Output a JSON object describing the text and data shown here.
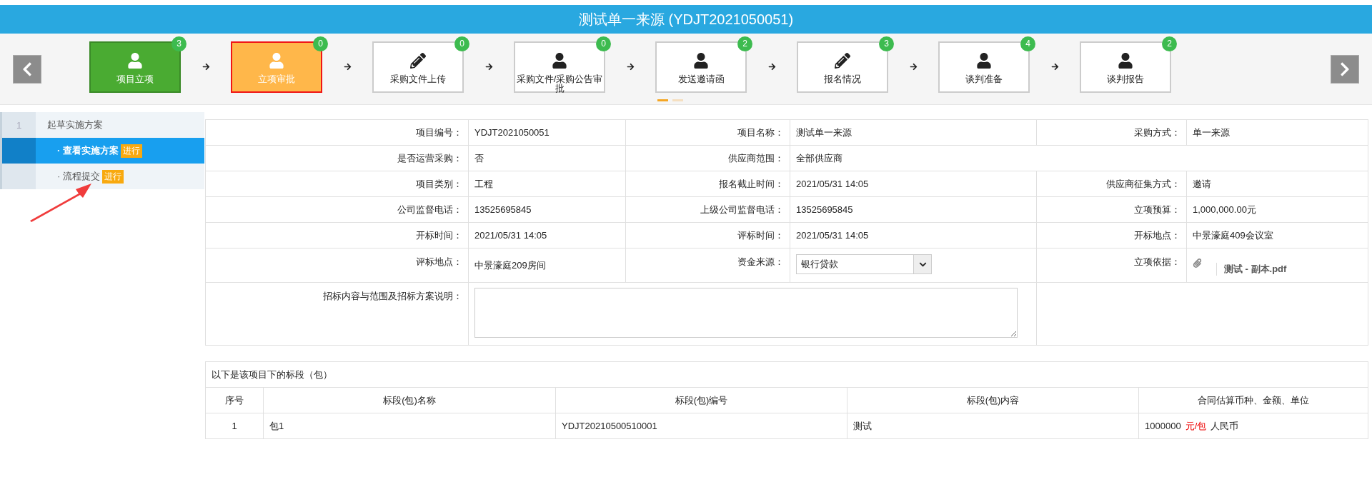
{
  "title": "测试单一来源 (YDJT2021050051)",
  "steps": [
    {
      "label": "项目立项",
      "badge": "3",
      "kind": "user",
      "done": true,
      "selected": false
    },
    {
      "label": "立项审批",
      "badge": "0",
      "kind": "user",
      "done": false,
      "selected": true
    },
    {
      "label": "采购文件上传",
      "badge": "0",
      "kind": "pencil",
      "done": false,
      "selected": false
    },
    {
      "label": "采购文件/采购公告审批",
      "badge": "0",
      "kind": "user",
      "done": false,
      "selected": false
    },
    {
      "label": "发送邀请函",
      "badge": "2",
      "kind": "user",
      "done": false,
      "selected": false
    },
    {
      "label": "报名情况",
      "badge": "3",
      "kind": "pencil",
      "done": false,
      "selected": false
    },
    {
      "label": "谈判准备",
      "badge": "4",
      "kind": "user",
      "done": false,
      "selected": false
    },
    {
      "label": "谈判报告",
      "badge": "2",
      "kind": "user",
      "done": false,
      "selected": false
    }
  ],
  "pager": [
    {
      "selected": true
    },
    {
      "selected": false
    }
  ],
  "sidebar": {
    "number": "1",
    "label": "起草实施方案",
    "items": [
      {
        "label": "· 查看实施方案",
        "badge": "进行",
        "selected": true
      },
      {
        "label": "· 流程提交",
        "badge": "进行",
        "selected": false
      }
    ]
  },
  "form": [
    [
      {
        "label": "项目编号：",
        "value": "YDJT2021050051",
        "kind": "text"
      },
      {
        "label": "项目名称：",
        "value": "测试单一来源",
        "kind": "text"
      },
      {
        "label": "采购方式：",
        "value": "单一来源",
        "kind": "text"
      }
    ],
    [
      {
        "label": "是否运营采购：",
        "value": "否",
        "kind": "text"
      },
      {
        "label": "供应商范围：",
        "value": "全部供应商",
        "kind": "text"
      }
    ],
    [
      {
        "label": "项目类别：",
        "value": "工程",
        "kind": "text"
      },
      {
        "label": "报名截止时间：",
        "value": "2021/05/31 14:05",
        "kind": "text"
      },
      {
        "label": "供应商征集方式：",
        "value": "邀请",
        "kind": "text"
      }
    ],
    [
      {
        "label": "公司监督电话：",
        "value": "13525695845",
        "kind": "text"
      },
      {
        "label": "上级公司监督电话：",
        "value": "13525695845",
        "kind": "text"
      },
      {
        "label": "立项预算：",
        "value": "1,000,000.00元",
        "kind": "text"
      }
    ],
    [
      {
        "label": "开标时间：",
        "value": "2021/05/31 14:05",
        "kind": "text"
      },
      {
        "label": "评标时间：",
        "value": "2021/05/31 14:05",
        "kind": "text"
      },
      {
        "label": "开标地点：",
        "value": "中景濠庭409会议室",
        "kind": "text"
      }
    ],
    [
      {
        "label": "评标地点：",
        "value": "中景濠庭209房间",
        "kind": "text"
      },
      {
        "label": "资金来源：",
        "value": "银行贷款",
        "kind": "select"
      },
      {
        "label": "立项依据：",
        "value": "测试 - 副本.pdf",
        "kind": "file"
      }
    ],
    [
      {
        "label": "招标内容与范围及招标方案说明：",
        "kind": "textarea"
      }
    ]
  ],
  "packages": {
    "caption": "以下是该项目下的标段（包）",
    "columns": [
      "序号",
      "标段(包)名称",
      "标段(包)编号",
      "标段(包)内容",
      "合同估算币种、金额、单位"
    ],
    "rows": [
      {
        "index": "1",
        "name": "包1",
        "code": "YDJT20210500510001",
        "content": "测试",
        "amount": "1000000",
        "unit": "元/包",
        "currency": "人民币"
      }
    ]
  }
}
